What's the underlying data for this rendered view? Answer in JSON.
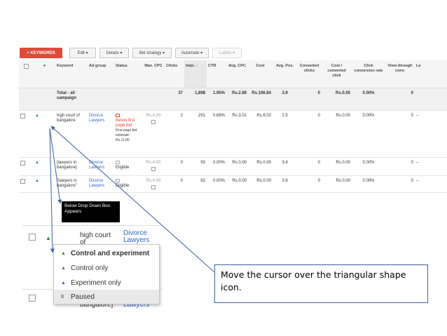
{
  "toolbar": {
    "keywords_button": "+ KEYWORDS",
    "edit": "Edit ▾",
    "details": "Details ▾",
    "bid_strategy": "Bid strategy ▾",
    "automate": "Automate ▾",
    "labels": "Labels ▾"
  },
  "columns": {
    "keyword": "Keyword",
    "ad_group": "Ad group",
    "status": "Status",
    "max_cpc": "Max. CPC",
    "clicks": "Clicks",
    "impr": "Impr.",
    "ctr": "CTR",
    "avg_cpc": "Avg. CPC",
    "cost": "Cost",
    "avg_pos": "Avg. Pos.",
    "converted_clicks": "Converted clicks",
    "cost_per_converted_click": "Cost / converted click",
    "click_conversion_rate": "Click conversion rate",
    "view_through_conv": "View-through conv.",
    "labels": "La"
  },
  "total": {
    "label": "Total - all campaign",
    "clicks": "37",
    "impr": "1,898",
    "ctr": "1.95%",
    "avg_cpc": "Rs.2.89",
    "cost": "Rs.106.84",
    "avg_pos": "3.9",
    "converted_clicks": "0",
    "cost_per_converted_click": "Rs.0.00",
    "click_conversion_rate": "0.00%",
    "view_through_conv": "0"
  },
  "rows": [
    {
      "keyword": "high court of bangalore",
      "ad_group": "Divorce Lawyers",
      "status": "Below first page bid",
      "status_note": "First page bid estimate: Rs.11.80",
      "max_cpc": "Rs.4.00",
      "clicks": "2",
      "impr": "291",
      "ctr": "0.69%",
      "avg_cpc": "Rs.3.01",
      "cost": "Rs.6.02",
      "avg_pos": "2.5",
      "converted_clicks": "0",
      "cost_per_converted_click": "Rs.0.00",
      "click_conversion_rate": "0.00%",
      "view_through_conv": "0",
      "labels": "--"
    },
    {
      "keyword": "[lawyers in bangalore]",
      "ad_group": "Divorce Lawyers",
      "status": "Eligible",
      "max_cpc": "Rs.4.00",
      "clicks": "0",
      "impr": "93",
      "ctr": "0.00%",
      "avg_cpc": "Rs.0.00",
      "cost": "Rs.0.00",
      "avg_pos": "3.4",
      "converted_clicks": "0",
      "cost_per_converted_click": "Rs.0.00",
      "click_conversion_rate": "0.00%",
      "view_through_conv": "0",
      "labels": "--"
    },
    {
      "keyword": "\"lawyers in bangalore\"",
      "ad_group": "Divorce Lawyers",
      "status": "Eligible",
      "max_cpc": "Rs.4.00",
      "clicks": "0",
      "impr": "82",
      "ctr": "0.00%",
      "avg_cpc": "Rs.0.00",
      "cost": "Rs.0.00",
      "avg_pos": "3.6",
      "converted_clicks": "0",
      "cost_per_converted_click": "Rs.0.00",
      "click_conversion_rate": "0.00%",
      "view_through_conv": "0",
      "labels": "--"
    }
  ],
  "callout_dropdown": "Below Drop Down Box Appears",
  "zoom": {
    "keyword_line1": "high court",
    "keyword_line2": "of",
    "ad_group_line1": "Divorce",
    "ad_group_line2": "Lawyers",
    "bottom_keyword": "bangalore]",
    "bottom_ad_group": "Lawyers"
  },
  "dropdown": {
    "items": [
      {
        "label": "Control and experiment",
        "icon": "flask-green-icon",
        "color": "#1e8e3e"
      },
      {
        "label": "Control only",
        "icon": "flask-grey-icon",
        "color": "#666666"
      },
      {
        "label": "Experiment only",
        "icon": "flask-blue-icon",
        "color": "#3366cc"
      },
      {
        "label": "Paused",
        "icon": "pause-icon",
        "color": "#666666"
      }
    ]
  },
  "callout_instruction": "Move the cursor over the triangular shape icon.",
  "colors": {
    "accent_red": "#dd4b39",
    "link_blue": "#3366cc",
    "arrow_blue": "#3a5fa0"
  }
}
